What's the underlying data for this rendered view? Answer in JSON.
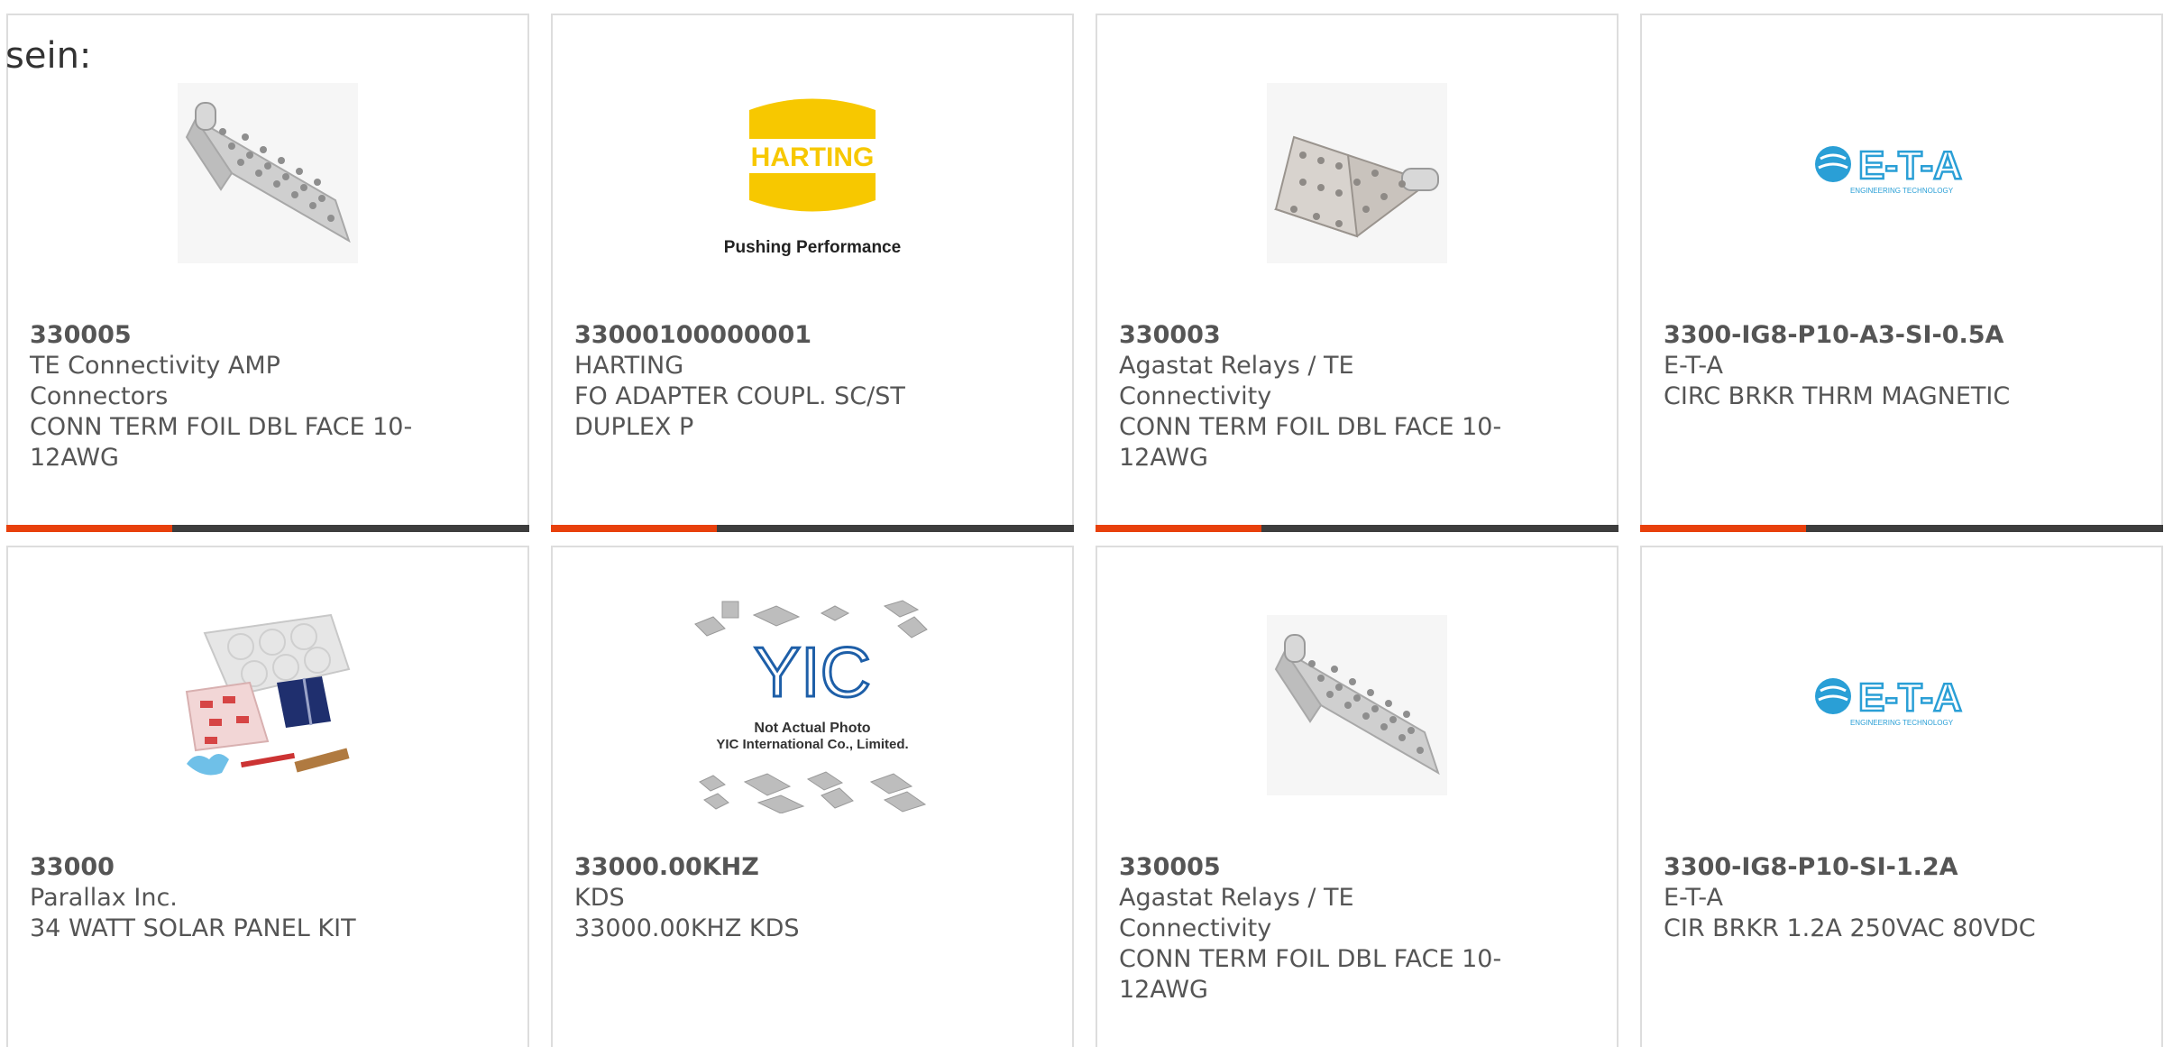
{
  "intro_text": "sein:",
  "products": [
    {
      "part_number": "330005",
      "manufacturer": "TE Connectivity AMP Connectors",
      "description": "CONN TERM FOIL DBL FACE 10-12AWG",
      "image": "foil-terminal-icon"
    },
    {
      "part_number": "33000100000001",
      "manufacturer": "HARTING",
      "description": "FO ADAPTER COUPL. SC/ST DUPLEX P",
      "image": "harting-logo",
      "logo_text": "HARTING",
      "logo_tagline": "Pushing Performance"
    },
    {
      "part_number": "330003",
      "manufacturer": "Agastat Relays / TE Connectivity",
      "description": "CONN TERM FOIL DBL FACE 10-12AWG",
      "image": "foil-terminal-icon"
    },
    {
      "part_number": "3300-IG8-P10-A3-SI-0.5A",
      "manufacturer": "E-T-A",
      "description": "CIRC BRKR THRM MAGNETIC",
      "image": "eta-logo",
      "logo_text": "E-T-A",
      "logo_tagline": "ENGINEERING TECHNOLOGY"
    },
    {
      "part_number": "33000",
      "manufacturer": "Parallax Inc.",
      "description": "34 WATT SOLAR PANEL KIT",
      "image": "solar-kit-icon"
    },
    {
      "part_number": "33000.00KHZ",
      "manufacturer": "KDS",
      "description": "33000.00KHZ KDS",
      "image": "yic-placeholder",
      "logo_text": "YIC",
      "logo_line1": "Not Actual Photo",
      "logo_line2": "YIC International Co., Limited."
    },
    {
      "part_number": "330005",
      "manufacturer": "Agastat Relays / TE Connectivity",
      "description": "CONN TERM FOIL DBL FACE 10-12AWG",
      "image": "foil-terminal-icon"
    },
    {
      "part_number": "3300-IG8-P10-SI-1.2A",
      "manufacturer": "E-T-A",
      "description": "CIR BRKR 1.2A 250VAC 80VDC",
      "image": "eta-logo",
      "logo_text": "E-T-A",
      "logo_tagline": "ENGINEERING TECHNOLOGY"
    }
  ],
  "colors": {
    "accent": "#e8400c",
    "bar": "#3d3d3d",
    "harting_yellow": "#f7c800",
    "eta_blue": "#2a9fd6",
    "yic_blue": "#1e5fa8"
  }
}
